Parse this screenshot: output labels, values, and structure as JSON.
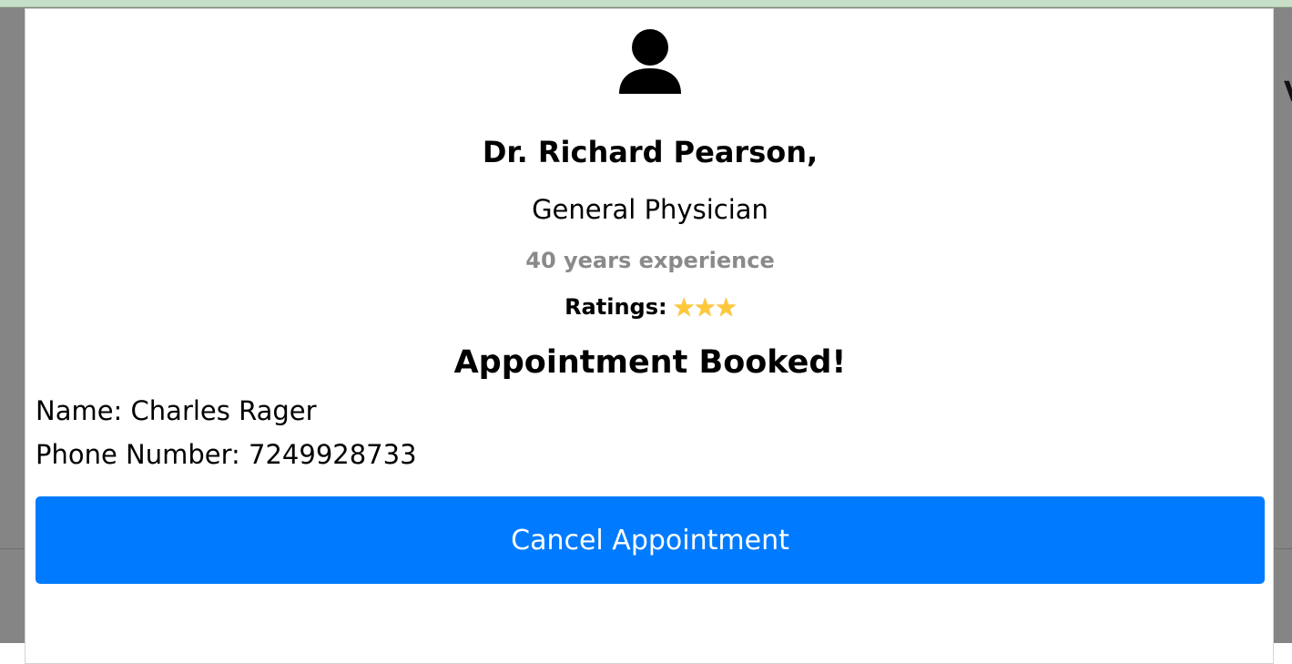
{
  "doctor": {
    "name": "Dr. Richard Pearson,",
    "specialty": "General Physician",
    "experience": "40 years experience",
    "ratings_label": "Ratings:",
    "ratings_stars": 3
  },
  "booking": {
    "status_title": "Appointment Booked!",
    "name_line": "Name: Charles Rager",
    "phone_line": "Phone Number: 7249928733",
    "cancel_label": "Cancel Appointment"
  },
  "icons": {
    "avatar": "user-icon",
    "star": "star-icon"
  },
  "colors": {
    "primary_button": "#007bff",
    "experience_text": "#8a8a8a",
    "star": "#ffc83a",
    "backdrop": "#858585"
  }
}
